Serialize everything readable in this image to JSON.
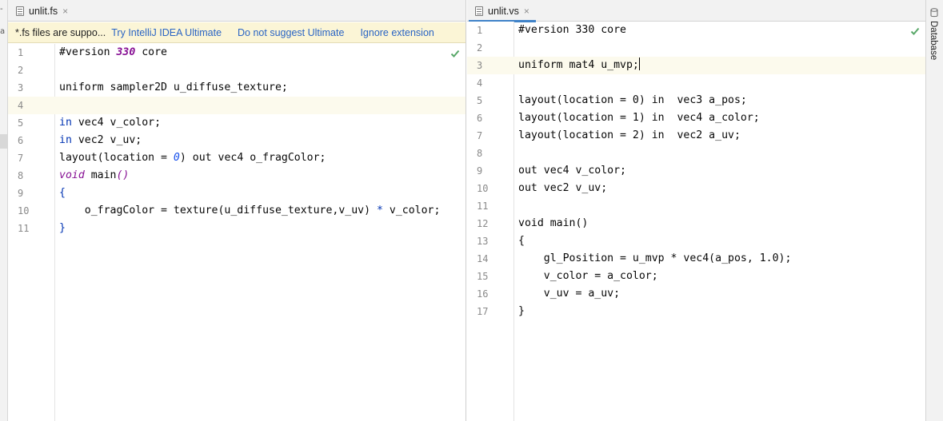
{
  "left_edge": {
    "glyphs": [
      "-",
      "a"
    ]
  },
  "left_pane": {
    "tab": {
      "label": "unlit.fs",
      "icon": "file-icon",
      "close": "×"
    },
    "notification": {
      "message": "*.fs files are suppo...",
      "links": [
        "Try IntelliJ IDEA Ultimate",
        "Do not suggest Ultimate",
        "Ignore extension"
      ]
    },
    "status_icon": "checkmark-icon",
    "current_line": 4,
    "lines": [
      {
        "no": "1",
        "segments": [
          {
            "t": "#version ",
            "c": "plain"
          },
          {
            "t": "330",
            "c": "num-purple"
          },
          {
            "t": " core",
            "c": "plain"
          }
        ]
      },
      {
        "no": "2",
        "segments": []
      },
      {
        "no": "3",
        "segments": [
          {
            "t": "uniform sampler2D u_diffuse_texture;",
            "c": "plain"
          }
        ]
      },
      {
        "no": "4",
        "segments": []
      },
      {
        "no": "5",
        "segments": [
          {
            "t": "in",
            "c": "kw"
          },
          {
            "t": " vec4 v_color;",
            "c": "plain"
          }
        ]
      },
      {
        "no": "6",
        "segments": [
          {
            "t": "in",
            "c": "kw"
          },
          {
            "t": " vec2 v_uv;",
            "c": "plain"
          }
        ]
      },
      {
        "no": "7",
        "segments": [
          {
            "t": "layout(location = ",
            "c": "plain"
          },
          {
            "t": "0",
            "c": "num"
          },
          {
            "t": ") out vec4 o_fragColor;",
            "c": "plain"
          }
        ]
      },
      {
        "no": "8",
        "segments": [
          {
            "t": "void",
            "c": "ital"
          },
          {
            "t": " main",
            "c": "plain"
          },
          {
            "t": "()",
            "c": "ital"
          }
        ]
      },
      {
        "no": "9",
        "segments": [
          {
            "t": "{",
            "c": "kw-b"
          }
        ]
      },
      {
        "no": "10",
        "segments": [
          {
            "t": "    o_fragColor = texture(u_diffuse_texture,v_uv) ",
            "c": "plain"
          },
          {
            "t": "*",
            "c": "kw"
          },
          {
            "t": " v_color;",
            "c": "plain"
          }
        ]
      },
      {
        "no": "11",
        "segments": [
          {
            "t": "}",
            "c": "kw-b"
          }
        ]
      }
    ]
  },
  "right_pane": {
    "tab": {
      "label": "unlit.vs",
      "icon": "file-icon",
      "close": "×"
    },
    "status_icon": "checkmark-icon",
    "current_line": 3,
    "lines": [
      {
        "no": "1",
        "segments": [
          {
            "t": "#version 330 core",
            "c": "plain"
          }
        ]
      },
      {
        "no": "2",
        "segments": []
      },
      {
        "no": "3",
        "segments": [
          {
            "t": "uniform mat4 u_mvp;",
            "c": "plain"
          }
        ],
        "caret": true
      },
      {
        "no": "4",
        "segments": []
      },
      {
        "no": "5",
        "segments": [
          {
            "t": "layout(location = 0) in  vec3 a_pos;",
            "c": "plain"
          }
        ]
      },
      {
        "no": "6",
        "segments": [
          {
            "t": "layout(location = 1) in  vec4 a_color;",
            "c": "plain"
          }
        ]
      },
      {
        "no": "7",
        "segments": [
          {
            "t": "layout(location = 2) in  vec2 a_uv;",
            "c": "plain"
          }
        ]
      },
      {
        "no": "8",
        "segments": []
      },
      {
        "no": "9",
        "segments": [
          {
            "t": "out vec4 v_color;",
            "c": "plain"
          }
        ]
      },
      {
        "no": "10",
        "segments": [
          {
            "t": "out vec2 v_uv;",
            "c": "plain"
          }
        ]
      },
      {
        "no": "11",
        "segments": []
      },
      {
        "no": "12",
        "segments": [
          {
            "t": "void main()",
            "c": "plain"
          }
        ]
      },
      {
        "no": "13",
        "segments": [
          {
            "t": "{",
            "c": "plain"
          }
        ]
      },
      {
        "no": "14",
        "segments": [
          {
            "t": "    gl_Position = u_mvp * vec4(a_pos, 1.0);",
            "c": "plain"
          }
        ]
      },
      {
        "no": "15",
        "segments": [
          {
            "t": "    v_color = a_color;",
            "c": "plain"
          }
        ]
      },
      {
        "no": "16",
        "segments": [
          {
            "t": "    v_uv = a_uv;",
            "c": "plain"
          }
        ]
      },
      {
        "no": "17",
        "segments": [
          {
            "t": "}",
            "c": "plain"
          }
        ]
      }
    ]
  },
  "right_toolbar": {
    "label": "Database",
    "icon": "database-icon"
  },
  "colors": {
    "accent": "#4083c9",
    "notification_bg": "#fbf5d6",
    "link": "#2a64c4",
    "check": "#59a869",
    "current_line": "#fcfaed"
  }
}
